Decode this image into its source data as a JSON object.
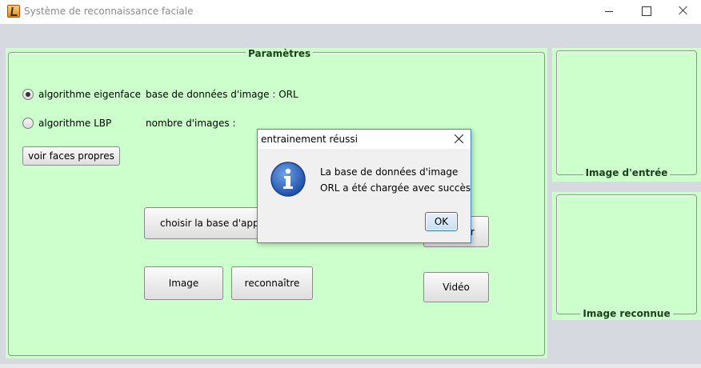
{
  "window": {
    "title": "Système de reconnaissance faciale",
    "minimize_icon": "minimize-icon",
    "maximize_icon": "maximize-icon",
    "close_icon": "close-icon"
  },
  "params_panel": {
    "title": "Paramètres",
    "radio_eigenface": {
      "label": "algorithme eigenface",
      "checked": true
    },
    "radio_lbp": {
      "label": "algorithme LBP",
      "checked": false
    },
    "database_label": "base de données  d'image : ORL",
    "image_count_label": "nombre d'images :",
    "buttons": {
      "eigenfaces": "voir faces propres",
      "choose_base": "choisir la base d'appre",
      "train_partial": "r",
      "image": "Image",
      "recognize": "reconnaître",
      "video": "Vidéo"
    }
  },
  "input_panel": {
    "caption": "Image d'entrée"
  },
  "output_panel": {
    "caption": "Image reconnue"
  },
  "dialog": {
    "title": "entrainement réussi",
    "icon": "info-icon",
    "message_line1": "La base de données d'image",
    "message_line2": "ORL a été chargée avec succès",
    "ok_label": "OK"
  },
  "colors": {
    "panel_bg": "#ccffcc",
    "client_bg": "#d6d9df",
    "dialog_border": "#3b8ad8",
    "panel_title": "#1c3e1c"
  }
}
